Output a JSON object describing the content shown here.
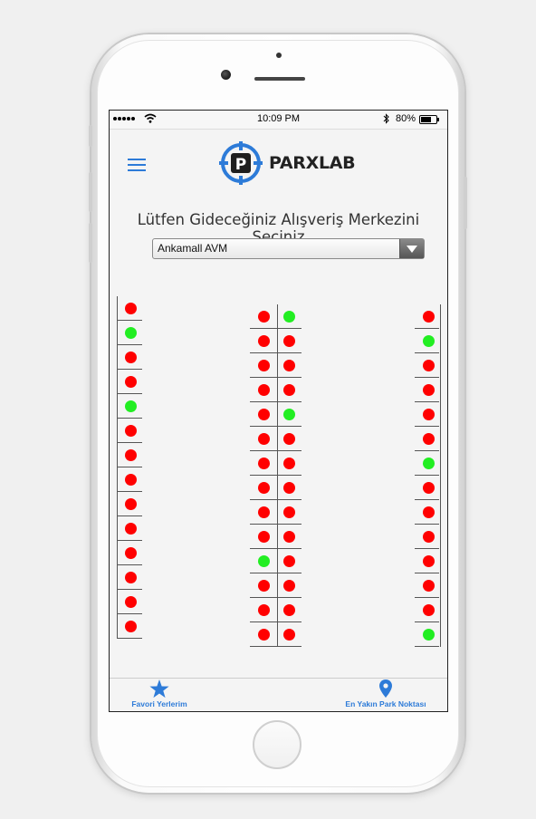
{
  "status_bar": {
    "time": "10:09 PM",
    "battery": "80%",
    "battery_level": 0.8
  },
  "header": {
    "menu_icon": "hamburger-icon",
    "logo_icon": "parking-target-icon",
    "logo_letter": "P",
    "logo_text": "PARXLAB"
  },
  "page_title": "Lütfen Gideceğiniz Alışveriş Merkezini Seçiniz",
  "mall_select": {
    "selected": "Ankamall AVM"
  },
  "colors": {
    "occupied": "#ff0000",
    "free": "#22ee22",
    "accent": "#2d7bd8"
  },
  "parking": {
    "left": [
      "occupied",
      "free",
      "occupied",
      "occupied",
      "free",
      "occupied",
      "occupied",
      "occupied",
      "occupied",
      "occupied",
      "occupied",
      "occupied",
      "occupied",
      "occupied"
    ],
    "mid_a": [
      "occupied",
      "occupied",
      "occupied",
      "occupied",
      "occupied",
      "occupied",
      "occupied",
      "occupied",
      "occupied",
      "occupied",
      "free",
      "occupied",
      "occupied",
      "occupied"
    ],
    "mid_b": [
      "free",
      "occupied",
      "occupied",
      "occupied",
      "free",
      "occupied",
      "occupied",
      "occupied",
      "occupied",
      "occupied",
      "occupied",
      "occupied",
      "occupied",
      "occupied"
    ],
    "right": [
      "occupied",
      "free",
      "occupied",
      "occupied",
      "occupied",
      "occupied",
      "free",
      "occupied",
      "occupied",
      "occupied",
      "occupied",
      "occupied",
      "occupied",
      "free"
    ]
  },
  "bottom_nav": [
    {
      "label": "Favori Yerlerim",
      "icon": "star-icon"
    },
    {
      "label": "En Yakın Park Noktası",
      "icon": "map-pin-icon"
    }
  ]
}
